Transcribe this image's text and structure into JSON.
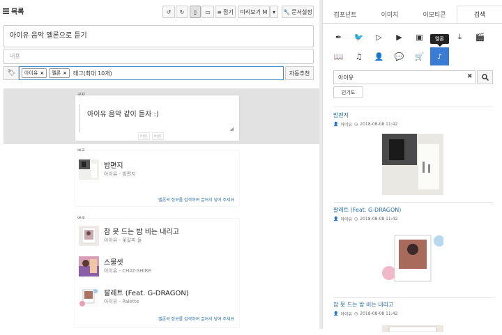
{
  "toolbar": {
    "list_label": "목록",
    "undo_icon": "undo-icon",
    "redo_icon": "redo-icon",
    "fold_label": "접기",
    "preview_label": "미리보기 M",
    "doc_settings_label": "문서설정"
  },
  "editor": {
    "title_value": "아이유 음악 멜론으로 듣기",
    "content_placeholder": "내용",
    "tags": [
      "아이유",
      "멜론"
    ],
    "tag_placeholder": "태그(최대 10개)",
    "auto_recommend_label": "자동추천",
    "notice_label": "공지",
    "notice_text": "아이유 음악 같이 듣자 :)",
    "notice_btn1": "버튼",
    "notice_btn2": "버튼",
    "melon_label1": "멜론",
    "melon_label2": "멜론",
    "card_footer": "멜론곡 정보를 검색하여 끌어서 넣어 주세요",
    "songs1": [
      {
        "title": "밤편지",
        "artist": "아이유 - 밤편지"
      }
    ],
    "songs2": [
      {
        "title": "잠 못 드는 밤 비는 내리고",
        "artist": "아이유 - 꽃갈피 둘"
      },
      {
        "title": "스물셋",
        "artist": "아이유 - CHAT-SHIRE"
      },
      {
        "title": "팔레트 (Feat. G-DRAGON)",
        "artist": "아이유 - Palette"
      }
    ]
  },
  "panel": {
    "tabs": [
      "컴포넌트",
      "이미지",
      "이모티콘",
      "검색"
    ],
    "active_tab": "검색",
    "tooltip": "멜론",
    "search_value": "아이유",
    "popularity_label": "인기도",
    "results": [
      {
        "title": "밤편지",
        "author": "아이유",
        "date": "2018-08-08 11:42"
      },
      {
        "title": "팔레트 (Feat. G-DRAGON)",
        "author": "아이유",
        "date": "2018-08-08 11:42"
      },
      {
        "title": "잠 못 드는 밤 비는 내리고",
        "author": "아이유",
        "date": "2018-08-08 11:42"
      }
    ]
  },
  "colors": {
    "accent": "#3a7bd5",
    "link": "#2a6fa8",
    "editor_bg": "#e2e2e2"
  }
}
